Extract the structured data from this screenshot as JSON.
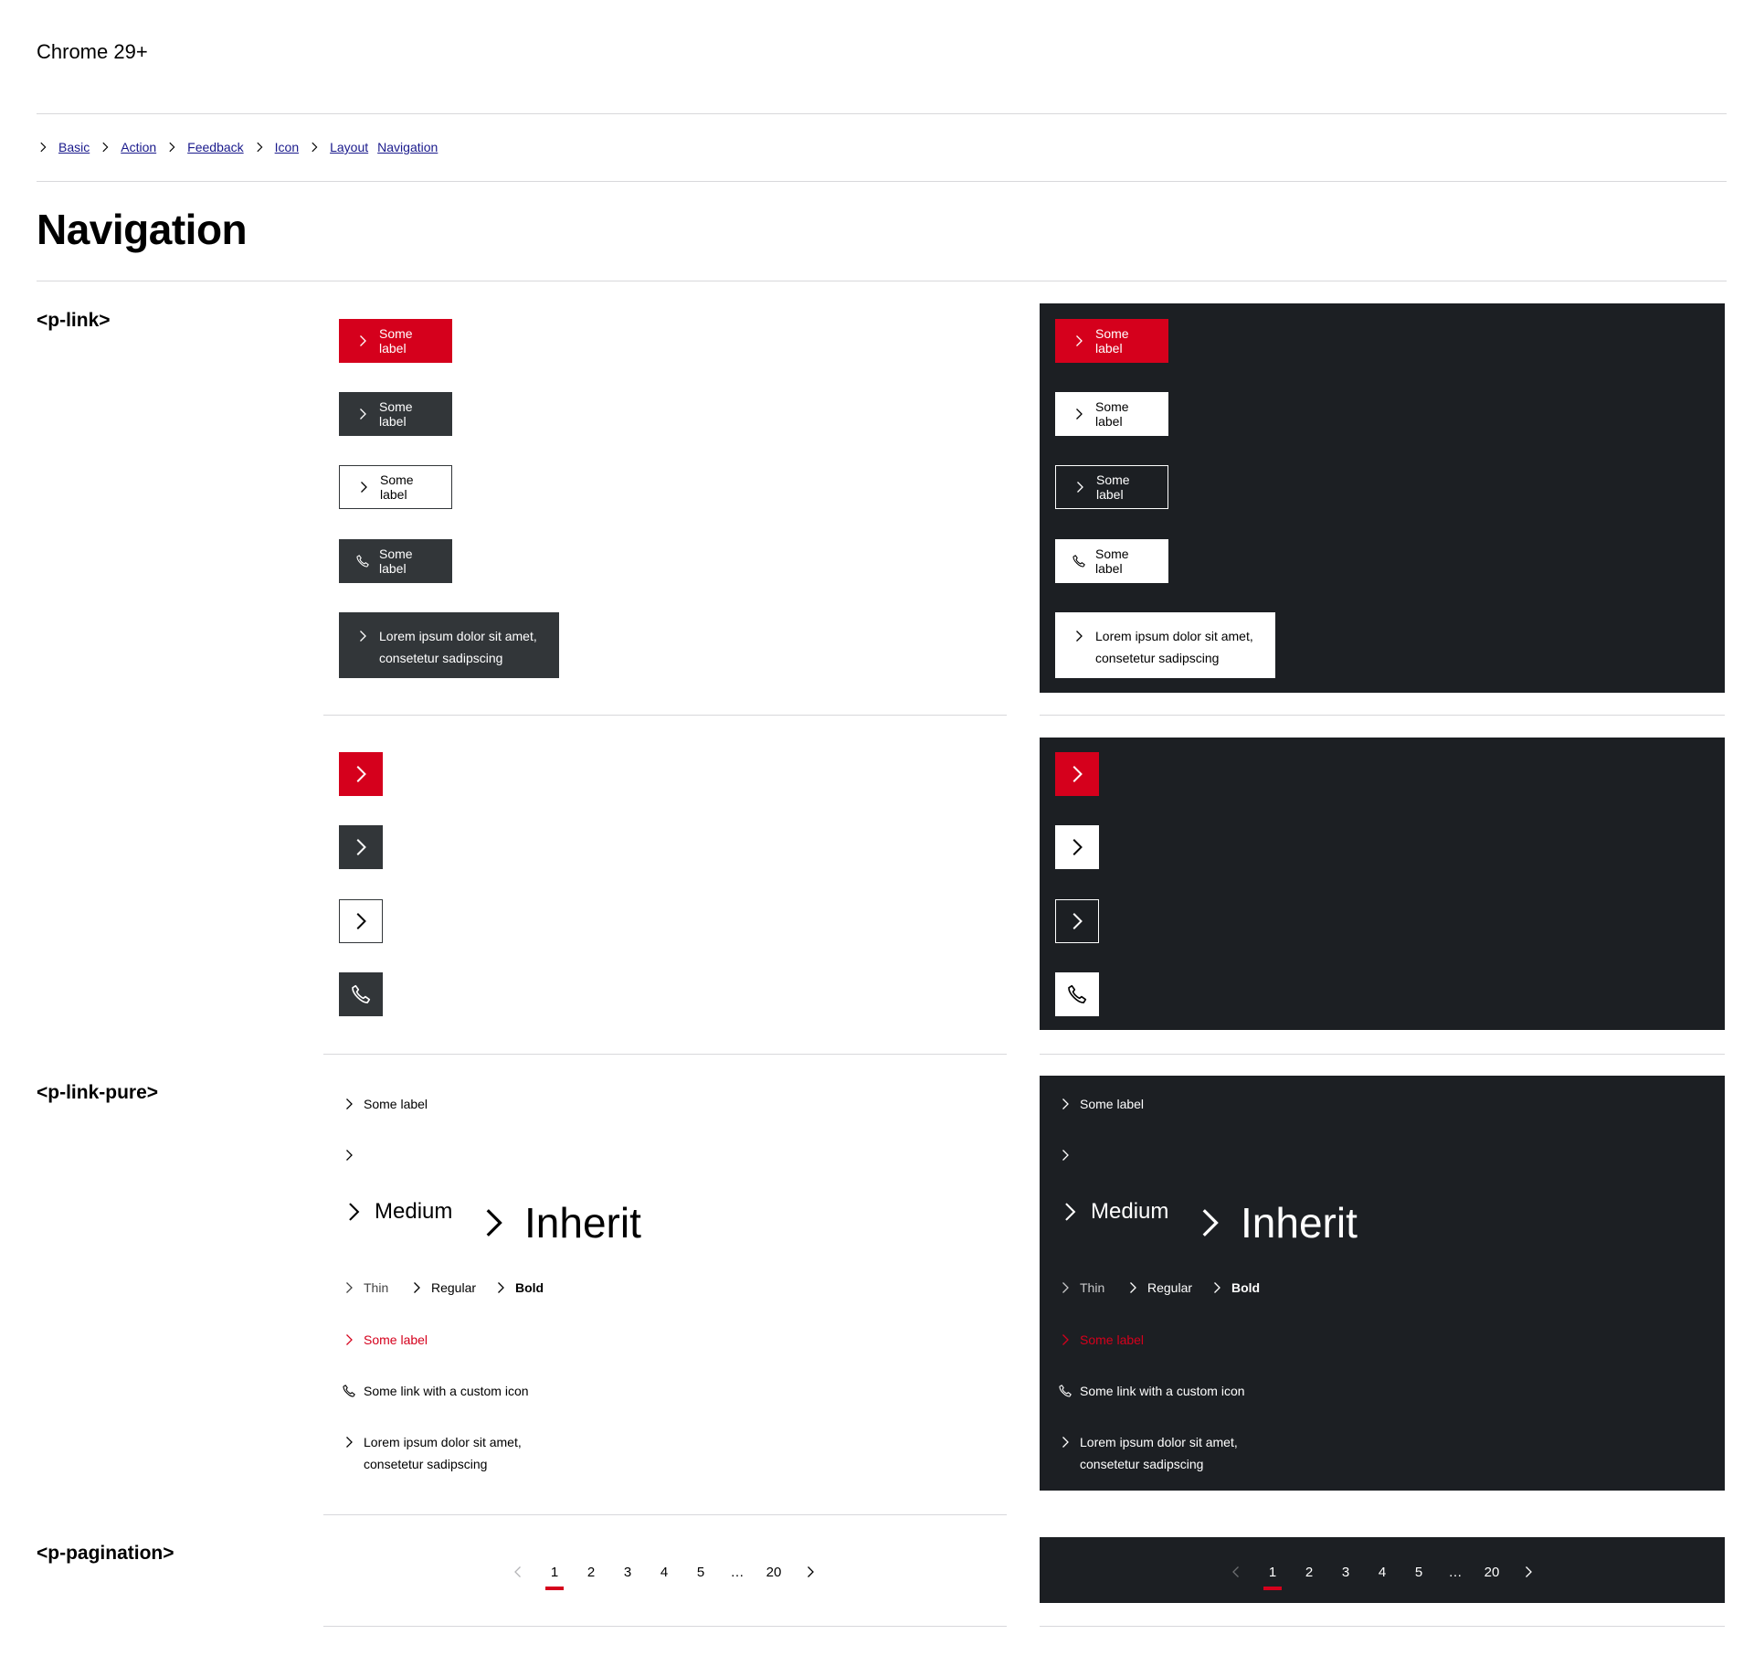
{
  "browser_label": "Chrome 29+",
  "breadcrumb": [
    "Basic",
    "Action",
    "Feedback",
    "Icon",
    "Layout",
    "Navigation"
  ],
  "page_title": "Navigation",
  "sections": {
    "link": "<p-link>",
    "link_pure": "<p-link-pure>",
    "pagination": "<p-pagination>"
  },
  "link": {
    "label": "Some label",
    "long_label_line1": "Lorem ipsum dolor sit amet,",
    "long_label_line2": "consetetur sadipscing"
  },
  "link_pure": {
    "label": "Some label",
    "medium": "Medium",
    "inherit": "Inherit",
    "thin": "Thin",
    "regular": "Regular",
    "bold": "Bold",
    "active_label": "Some label",
    "custom_icon_label": "Some link with a custom icon",
    "long_line1": "Lorem ipsum dolor sit amet,",
    "long_line2": "consetetur sadipscing"
  },
  "pagination": {
    "pages": [
      "1",
      "2",
      "3",
      "4",
      "5",
      "…",
      "20"
    ],
    "current": "1"
  },
  "colors": {
    "brand_red": "#d5001c",
    "dark_bg": "#1c1f23",
    "secondary": "#323639",
    "link_text": "#1a1a8c"
  },
  "icons": [
    "arrow-head-right-icon",
    "arrow-head-left-icon",
    "phone-icon"
  ]
}
